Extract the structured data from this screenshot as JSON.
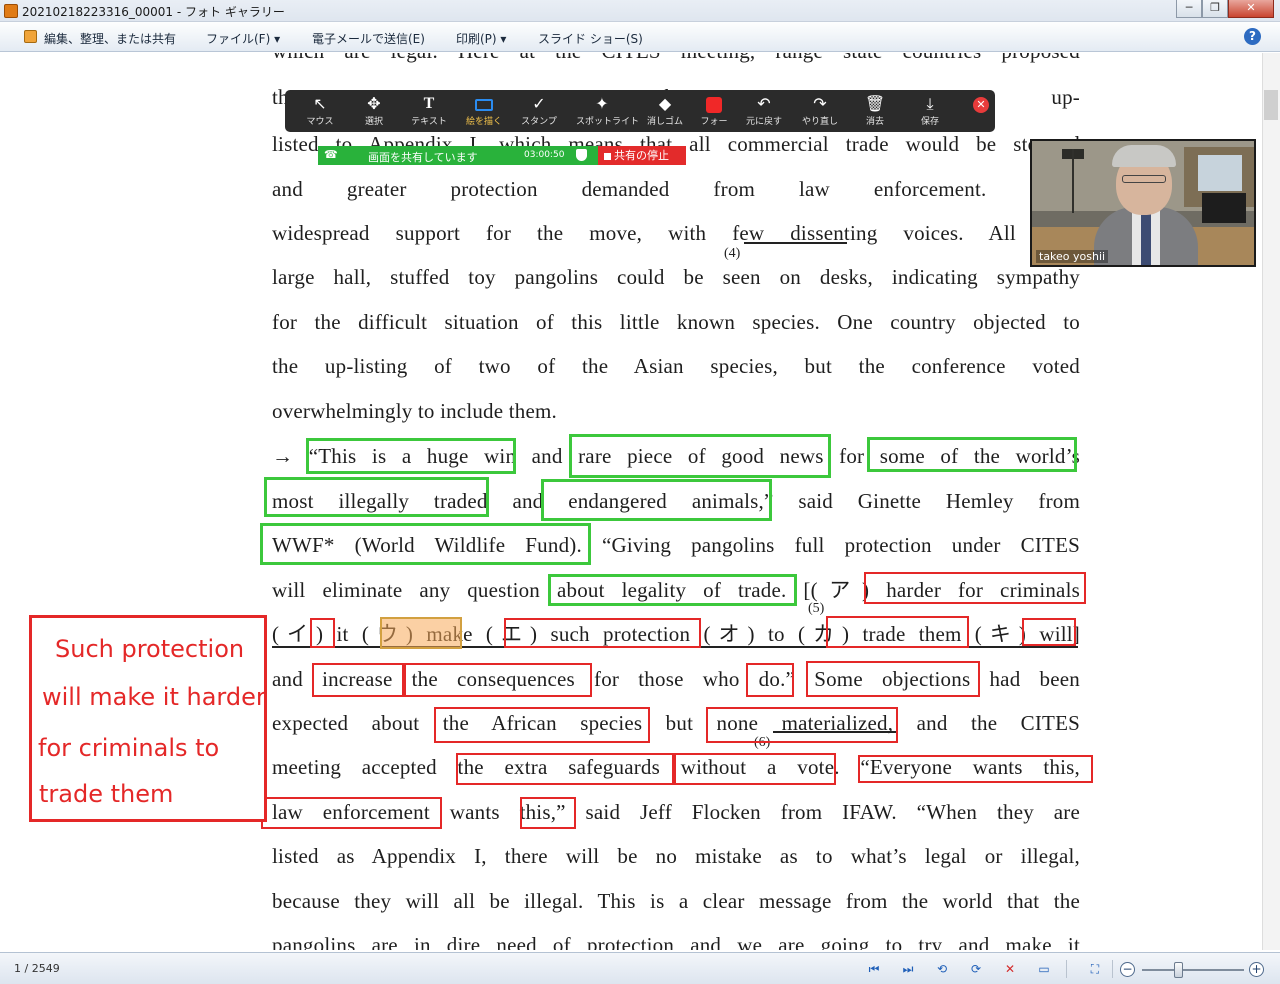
{
  "window": {
    "title": "20210218223316_00001 - フォト ギャラリー",
    "minimize": "─",
    "restore": "❐",
    "close": "✕"
  },
  "menu": {
    "items": [
      "編集、整理、または共有",
      "ファイル(F) ▾",
      "電子メールで送信(E)",
      "印刷(P) ▾",
      "スライド ショー(S)"
    ],
    "help": "?"
  },
  "zoom_toolbar": {
    "tools": [
      {
        "icon": "↖",
        "label": "マウス"
      },
      {
        "icon": "✥",
        "label": "選択"
      },
      {
        "icon": "T",
        "label": "テキスト"
      },
      {
        "icon": "",
        "label": "絵を描く"
      },
      {
        "icon": "✓",
        "label": "スタンプ"
      },
      {
        "icon": "✦",
        "label": "スポットライト"
      },
      {
        "icon": "◆",
        "label": "消しゴム"
      },
      {
        "icon": "",
        "label": "フォー"
      },
      {
        "icon": "↶",
        "label": "元に戻す"
      },
      {
        "icon": "↷",
        "label": "やり直し"
      },
      {
        "icon": "🗑",
        "label": "消去"
      },
      {
        "icon": "⤓",
        "label": "保存"
      }
    ],
    "active_tool": "絵を描く",
    "close": "✕"
  },
  "share_bar": {
    "text": "画面を共有しています",
    "time": "03:00:50",
    "stop_label": "共有の停止"
  },
  "video": {
    "name": "takeo yoshii"
  },
  "document": {
    "lines": [
      "which are legal.  Here at the CITES meeting, range state countries  proposed",
      "the                                                                              be up-",
      "listed to Appendix  I,  which means that all commercial trade would be stopped",
      "and greater protection demanded from law enforcement.  There",
      "widespread support for the move, with few dissenting voices.  All over",
      "large hall, stuffed toy pangolins could be seen on desks, indicating sympathy",
      "for the difficult situation of this little known species.  One country objected to",
      "the up-listing of two of the Asian species, but the conference voted",
      "overwhelmingly to include them.",
      "→ “This is a huge win and rare piece of good news for some of the world’s",
      "most illegally traded and endangered animals,” said Ginette Hemley from",
      "WWF* (World Wildlife Fund). “Giving pangolins full protection under CITES",
      "will eliminate any question about legality of trade.  [(ア) harder for criminals",
      "(イ) it  (ウ) make  (エ) such protection  (オ) to  (カ) trade them  (キ) will]",
      "and increase the consequences for those who do.”  Some objections had been",
      "expected about the African species but none materialized, and the CITES",
      "meeting accepted the extra safeguards without a vote.  “Everyone wants this,",
      "law enforcement wants this,” said Jeff Flocken from IFAW.  “When they are",
      "listed as Appendix I, there will be no mistake as to what’s legal or illegal,",
      "because they will all be illegal.  This is a clear message from the world that the",
      "pangolins are in dire need of protection and we are going to try and make it"
    ],
    "footnotes": [
      "(4)",
      "(5)",
      "(6)"
    ]
  },
  "note": {
    "lines": [
      "Such protection",
      "will make it harder",
      "for criminals to",
      "trade them"
    ]
  },
  "status": {
    "page_count": "1 / 2549",
    "icons": [
      "⏮",
      "⏭",
      "⟲",
      "⟳",
      "✕",
      "▭",
      "⛶",
      "−",
      "+"
    ]
  },
  "colors": {
    "green_box": "#3cc83c",
    "red_box": "#e42828",
    "share_green": "#29b23b",
    "toolbar_bg": "#2b2b2b"
  }
}
